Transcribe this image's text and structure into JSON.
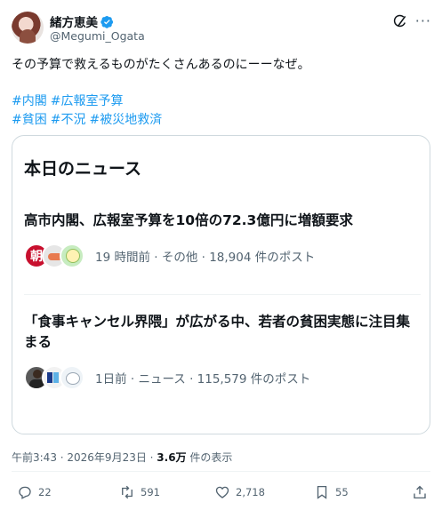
{
  "author": {
    "name": "緒方恵美",
    "handle": "@Megumi_Ogata"
  },
  "tweet": {
    "text": "その予算で救えるものがたくさんあるのにーーなぜ。",
    "hashtags": [
      "#内閣",
      "#広報室予算",
      "#貧困",
      "#不況",
      "#被災地救済"
    ]
  },
  "card": {
    "title": "本日のニュース",
    "items": [
      {
        "headline": "高市内閣、広報室予算を10倍の72.3億円に増額要求",
        "meta": "19 時間前 · その他 · 18,904 件のポスト",
        "avatar_label": "朝"
      },
      {
        "headline": "「食事キャンセル界隈」が広がる中、若者の貧困実態に注目集まる",
        "meta": "1日前 · ニュース · 115,579 件のポスト"
      }
    ]
  },
  "timestamp": {
    "time": "午前3:43 · 2026年9月23日 · ",
    "views": "3.6万",
    "views_suffix": " 件の表示"
  },
  "actions": {
    "replies": "22",
    "reposts": "591",
    "likes": "2,718",
    "bookmarks": "55"
  },
  "colors": {
    "accent": "#1d9bf0",
    "text": "#0f1419",
    "secondary": "#536471",
    "border": "#cfd9de"
  }
}
